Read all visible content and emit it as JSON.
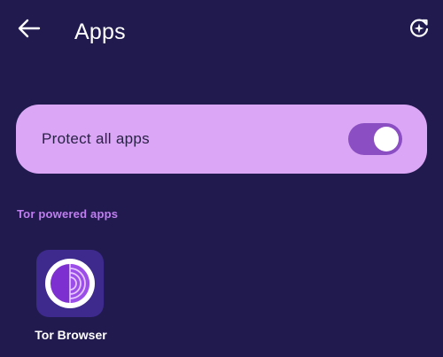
{
  "header": {
    "title": "Apps",
    "back_icon": "arrow-left-icon",
    "refresh_icon": "refresh-sparkle-icon"
  },
  "protect_all": {
    "label": "Protect all apps",
    "enabled": true
  },
  "section": {
    "title": "Tor powered apps"
  },
  "apps": [
    {
      "name": "Tor Browser",
      "icon": "tor-browser-icon"
    }
  ],
  "colors": {
    "background": "#201a4f",
    "card": "#dba6f5",
    "toggle_track": "#8b4fc3",
    "accent_text": "#c17ef0",
    "app_icon_bg": "#3d2a8c"
  }
}
